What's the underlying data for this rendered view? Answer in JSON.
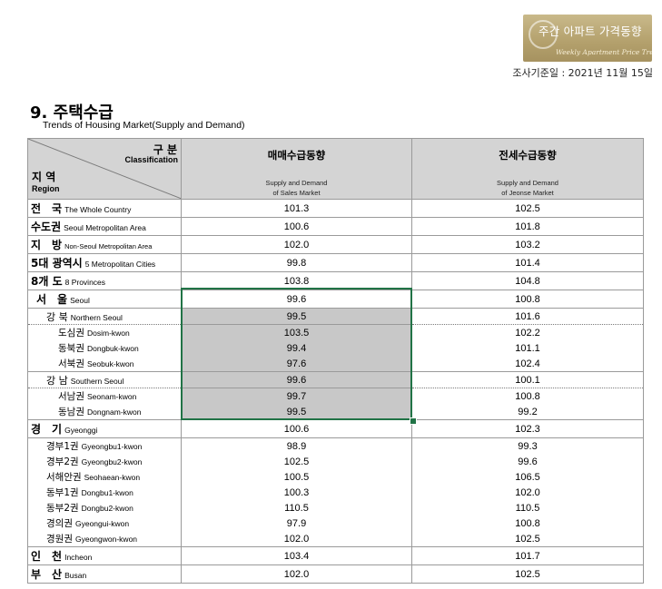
{
  "header": {
    "badge_title": "주간 아파트 가격동향",
    "badge_subtitle": "Weekly Apartment Price Trends",
    "survey_date": "조사기준일 : 2021년 11월 15일"
  },
  "section": {
    "title": "9. 주택수급",
    "subtitle": "Trends of Housing Market(Supply and Demand)"
  },
  "table": {
    "corner": {
      "classification_ko": "구 분",
      "classification_en": "Classification",
      "region_ko": "지 역",
      "region_en": "Region"
    },
    "columns": [
      {
        "title": "매매수급동향",
        "sub1": "Supply and Demand",
        "sub2": "of Sales Market"
      },
      {
        "title": "전세수급동향",
        "sub1": "Supply and Demand",
        "sub2": "of Jeonse Market"
      }
    ],
    "rows": [
      {
        "ko": "전　국",
        "en": "The Whole Country",
        "sales": "101.3",
        "jeonse": "102.5"
      },
      {
        "ko": "수도권",
        "en": "Seoul Metropolitan Area",
        "sales": "100.6",
        "jeonse": "101.8"
      },
      {
        "ko": "지　방",
        "en": "Non-Seoul Metropolitan Area",
        "sales": "102.0",
        "jeonse": "103.2"
      },
      {
        "ko": "5대 광역시",
        "en": "5 Metropolitan Cities",
        "sales": "99.8",
        "jeonse": "101.4"
      },
      {
        "ko": "8개 도",
        "en": "8 Provinces",
        "sales": "103.8",
        "jeonse": "104.8"
      },
      {
        "ko": "서　울",
        "en": "Seoul",
        "sales": "99.6",
        "jeonse": "100.8"
      },
      {
        "ko": "강 북",
        "en": "Northern Seoul",
        "sales": "99.5",
        "jeonse": "101.6"
      },
      {
        "ko": "도심권",
        "en": "Dosim-kwon",
        "sales": "103.5",
        "jeonse": "102.2"
      },
      {
        "ko": "동북권",
        "en": "Dongbuk-kwon",
        "sales": "99.4",
        "jeonse": "101.1"
      },
      {
        "ko": "서북권",
        "en": "Seobuk-kwon",
        "sales": "97.6",
        "jeonse": "102.4"
      },
      {
        "ko": "강 남",
        "en": "Southern Seoul",
        "sales": "99.6",
        "jeonse": "100.1"
      },
      {
        "ko": "서남권",
        "en": "Seonam-kwon",
        "sales": "99.7",
        "jeonse": "100.8"
      },
      {
        "ko": "동남권",
        "en": "Dongnam-kwon",
        "sales": "99.5",
        "jeonse": "99.2"
      },
      {
        "ko": "경　기",
        "en": "Gyeonggi",
        "sales": "100.6",
        "jeonse": "102.3"
      },
      {
        "ko": "경부1권",
        "en": "Gyeongbu1-kwon",
        "sales": "98.9",
        "jeonse": "99.3"
      },
      {
        "ko": "경부2권",
        "en": "Gyeongbu2-kwon",
        "sales": "102.5",
        "jeonse": "99.6"
      },
      {
        "ko": "서해안권",
        "en": "Seohaean-kwon",
        "sales": "100.5",
        "jeonse": "106.5"
      },
      {
        "ko": "동부1권",
        "en": "Dongbu1-kwon",
        "sales": "100.3",
        "jeonse": "102.0"
      },
      {
        "ko": "동부2권",
        "en": "Dongbu2-kwon",
        "sales": "110.5",
        "jeonse": "110.5"
      },
      {
        "ko": "경의권",
        "en": "Gyeongui-kwon",
        "sales": "97.9",
        "jeonse": "100.8"
      },
      {
        "ko": "경원권",
        "en": "Gyeongwon-kwon",
        "sales": "102.0",
        "jeonse": "102.5"
      },
      {
        "ko": "인　천",
        "en": "Incheon",
        "sales": "103.4",
        "jeonse": "101.7"
      },
      {
        "ko": "부　산",
        "en": "Busan",
        "sales": "102.0",
        "jeonse": "102.5"
      }
    ]
  }
}
